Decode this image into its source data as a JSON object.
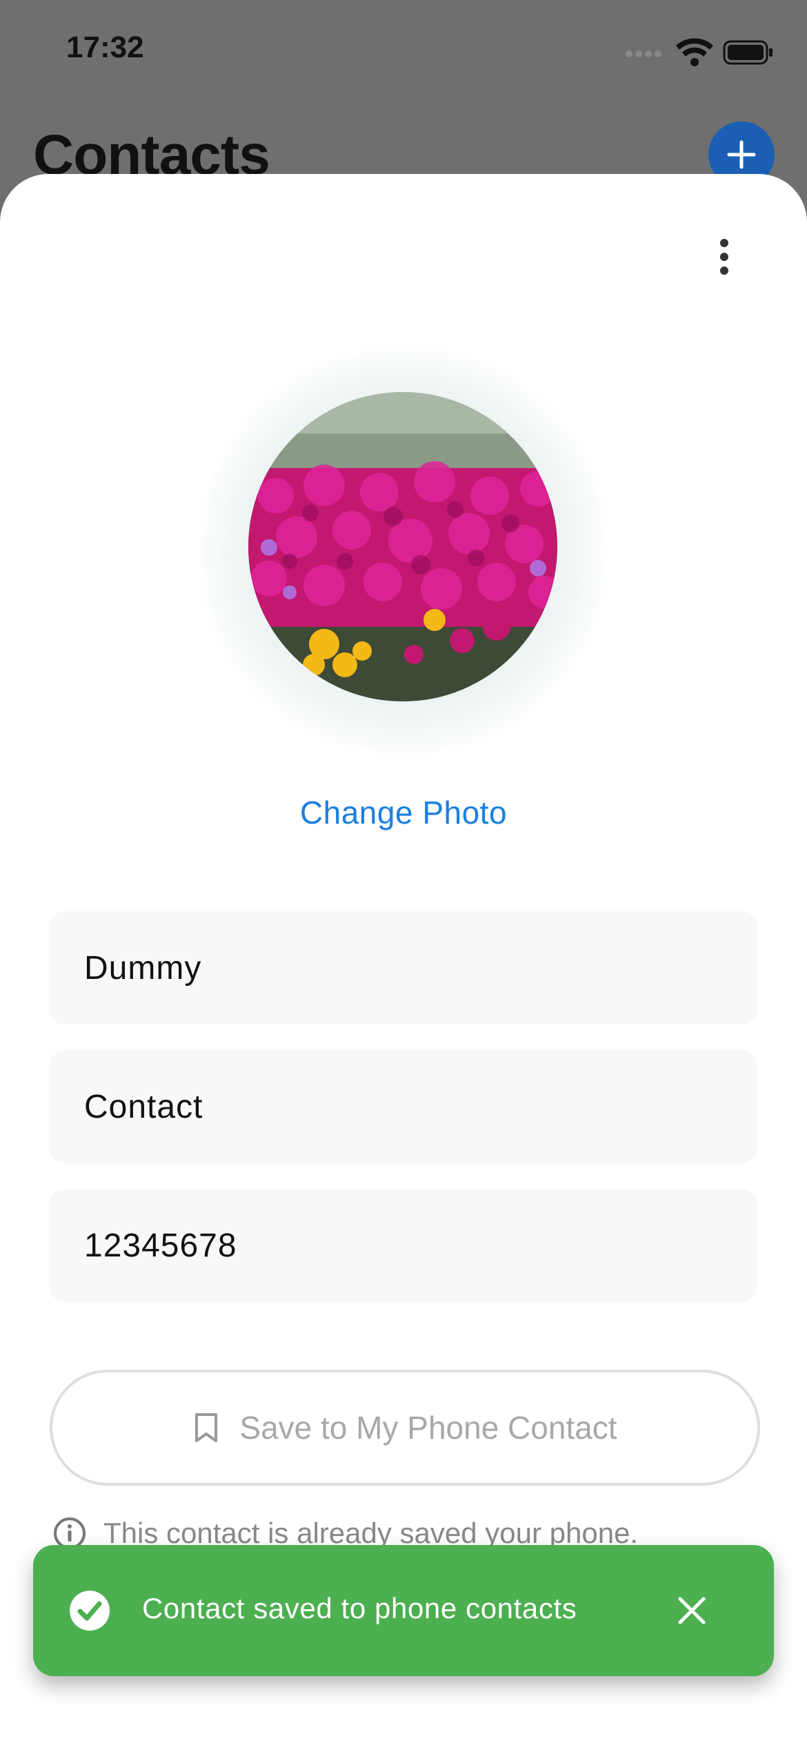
{
  "status_bar": {
    "time": "17:32",
    "icons": [
      "signal-icon",
      "wifi-icon",
      "battery-icon"
    ]
  },
  "header": {
    "title": "Contacts",
    "add_icon": "plus-icon"
  },
  "sheet": {
    "more_icon": "more-vertical-icon",
    "change_photo_label": "Change Photo",
    "fields": {
      "first_name": "Dummy",
      "last_name": "Contact",
      "phone": "12345678"
    },
    "save_button_label": "Save to My Phone Contact",
    "info_text": "This contact is already saved your phone."
  },
  "toast": {
    "message": "Contact saved to phone contacts",
    "icon": "check-circle-icon",
    "close_icon": "close-icon",
    "color": "#4caf50"
  },
  "colors": {
    "accent": "#1a7fe0",
    "fab": "#1a5fb4",
    "toast": "#4caf50"
  }
}
